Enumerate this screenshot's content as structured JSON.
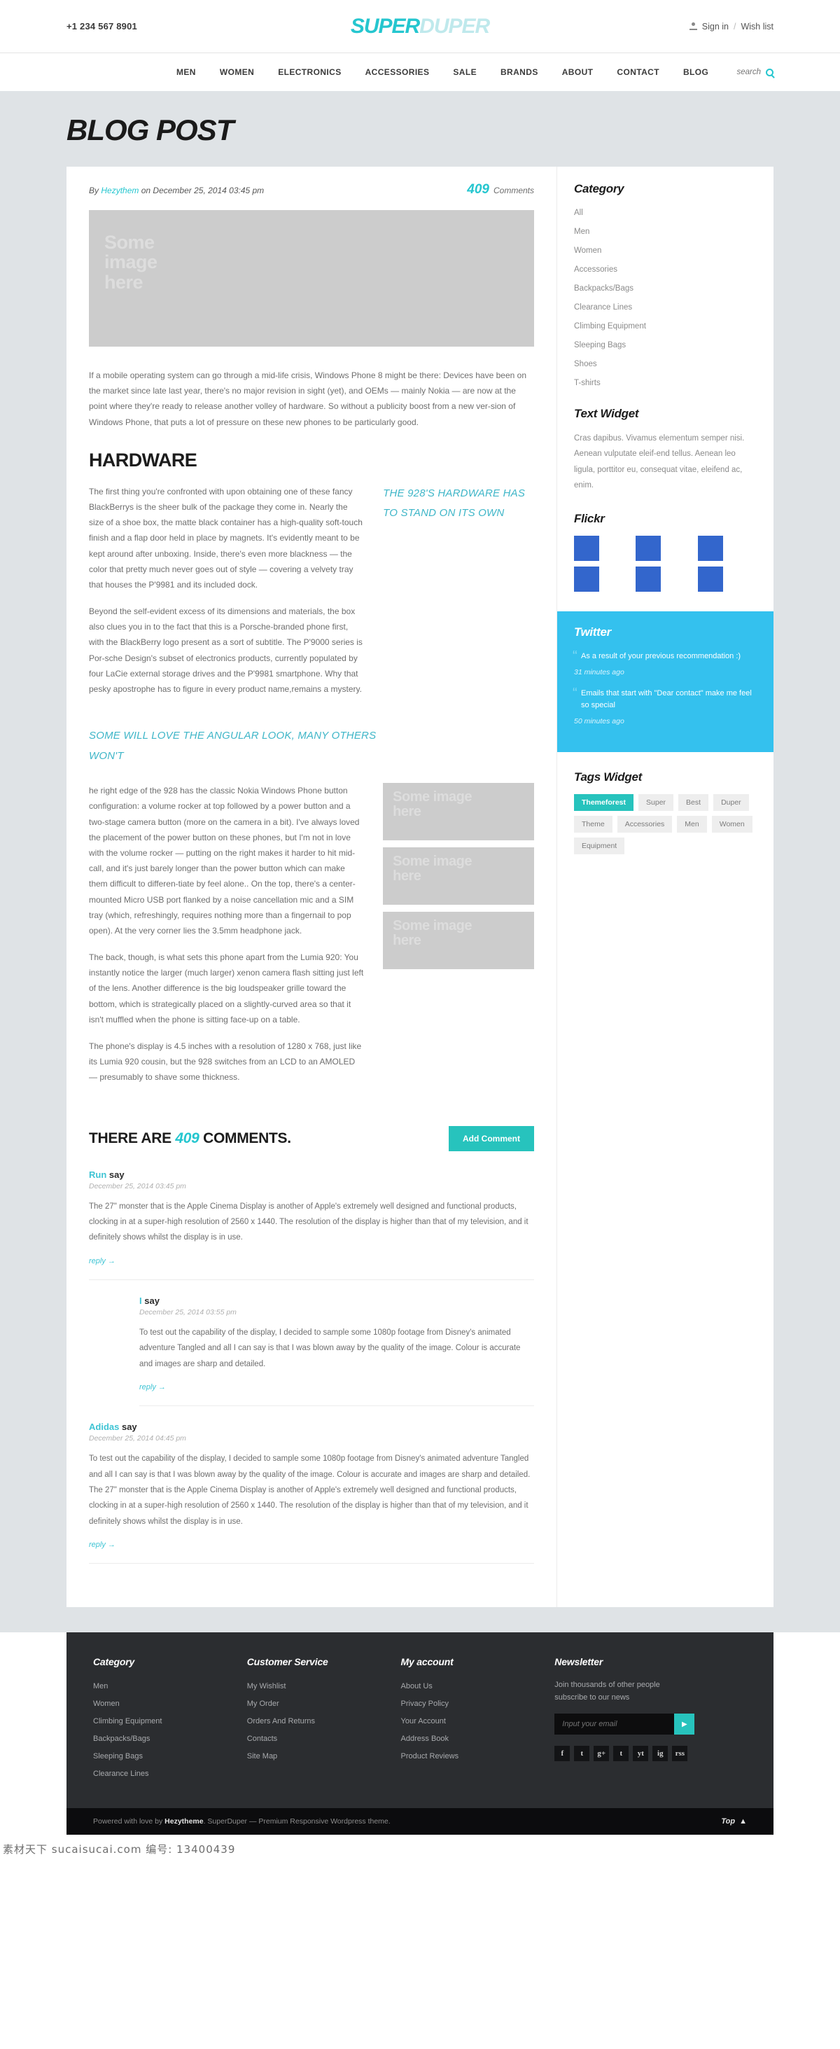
{
  "header": {
    "phone": "+1 234 567 8901",
    "logo_part1": "SUPER",
    "logo_part2": "DUPER",
    "sign_in": "Sign in",
    "separator": "/",
    "wish_list": "Wish list",
    "nav": [
      "MEN",
      "WOMEN",
      "ELECTRONICS",
      "ACCESSORIES",
      "SALE",
      "BRANDS",
      "ABOUT",
      "CONTACT",
      "BLOG"
    ],
    "search_placeholder": "search"
  },
  "banner": {
    "title": "BLOG POST"
  },
  "post": {
    "meta_by": "By",
    "meta_author": "Hezythem",
    "meta_on": "on December 25, 2014 03:45 pm",
    "comment_count": "409",
    "comment_label": "Comments",
    "hero_placeholder": "Some image here",
    "intro": "If a mobile operating system can go through a mid-life crisis, Windows Phone 8 might be there: Devices have been on the market since late last year, there's no major revision in sight (yet), and OEMs — mainly Nokia — are now at the point where they're ready to release another volley of hardware. So without a publicity boost from a new ver-sion of Windows Phone, that puts a lot of pressure on these new phones to be particularly good.",
    "section_title": "HARDWARE",
    "para1": "The first thing you're confronted with upon obtaining one of these fancy BlackBerrys is the sheer bulk of the package they come in. Nearly the size of a shoe box, the matte black container has a high-quality soft-touch finish and a flap door held in place by magnets. It's evidently meant to be kept around after unboxing. Inside, there's even more blackness — the color that pretty much never goes out of style — covering a velvety tray that houses the P'9981 and its included dock.",
    "para2": "Beyond the self-evident excess of its dimensions and materials, the box also clues you in to the fact that this is a Porsche-branded phone first, with the BlackBerry logo present as a sort of subtitle. The P'9000 series is Por-sche Design's subset of electronics products, currently populated by four LaCie external storage drives and the P'9981 smartphone. Why that pesky apostrophe has to figure in every product name,remains a mystery.",
    "pull_quote_1": "THE 928'S HARDWARE HAS TO STAND ON ITS OWN",
    "pull_quote_2": "SOME WILL LOVE THE ANGULAR LOOK, MANY OTHERS WON'T",
    "para3": "he right edge of the 928 has the classic Nokia Windows Phone button configuration: a volume rocker at top followed by a power button and a two-stage camera button (more on the camera in a bit). I've always loved the placement of the power button on these phones, but I'm not in love with the volume rocker — putting on the right makes it harder to hit mid-call, and it's just barely longer than the power button which can make them difficult to differen-tiate by feel alone.. On the top, there's a center-mounted Micro USB port flanked by a noise cancellation mic and a SIM tray (which, refreshingly, requires nothing more than a fingernail to pop open). At the very corner lies the 3.5mm headphone jack.",
    "para4": "The back, though, is what sets this phone apart from the Lumia 920: You instantly notice the larger (much larger) xenon camera flash sitting just left of the lens. Another difference is the big loudspeaker grille toward the bottom, which is strategically placed on a slightly-curved area so that it isn't muffled when the phone is sitting face-up on a table.",
    "para5": "The phone's display is 4.5 inches with a resolution of 1280 x 768, just like its Lumia 920 cousin, but the 928 switches from an LCD to an AMOLED — presumably to shave some thickness.",
    "inline_image_placeholder": "Some image here"
  },
  "comments": {
    "heading_prefix": "THERE ARE",
    "heading_count": "409",
    "heading_suffix": "COMMENTS.",
    "add_button": "Add Comment",
    "say_label": "say",
    "reply_label": "reply →",
    "items": [
      {
        "author": "Run",
        "date": "December 25, 2014 03:45 pm",
        "text": "The 27\" monster that is the Apple Cinema Display is another of Apple's extremely well designed and functional products, clocking in at a super-high resolution of 2560 x 1440. The resolution of the display is higher than that of my television, and it definitely shows whilst the display is in use.",
        "nested": false
      },
      {
        "author": "I",
        "date": "December 25, 2014 03:55 pm",
        "text": "To test out the capability of the display, I decided to sample some 1080p footage from Disney's animated adventure Tangled and all I can say is that I was blown away by the quality of the image. Colour is accurate and images are sharp and detailed.",
        "nested": true
      },
      {
        "author": "Adidas",
        "date": "December 25, 2014 04:45 pm",
        "text": "To test out the capability of the display, I decided to sample some 1080p footage from Disney's animated adventure Tangled and all I can say is that I was blown away by the quality of the image. Colour is accurate and images are sharp and detailed. The 27\" monster that is the Apple Cinema Display is another of Apple's extremely well designed and functional products, clocking in at a super-high resolution of 2560 x 1440. The resolution of the display is higher than that of my television, and it definitely shows whilst the display is in use.",
        "nested": false
      }
    ]
  },
  "sidebar": {
    "category_title": "Category",
    "categories": [
      "All",
      "Men",
      "Women",
      "Accessories",
      "Backpacks/Bags",
      "Clearance Lines",
      "Climbing Equipment",
      "Sleeping Bags",
      "Shoes",
      "T-shirts"
    ],
    "text_widget_title": "Text Widget",
    "text_widget_body": "Cras dapibus. Vivamus elementum semper nisi. Aenean vulputate eleif-end tellus. Aenean leo ligula, porttitor eu, consequat vitae, eleifend ac, enim.",
    "flickr_title": "Flickr",
    "flickr_color": "#3366cc",
    "twitter_title": "Twitter",
    "twitter_bg": "#34c1ee",
    "tweets": [
      {
        "text": "As a result of your previous recommendation :)",
        "time": "31 minutes ago"
      },
      {
        "text": "Emails that start with \"Dear contact\" make me feel so special",
        "time": "50 minutes ago"
      }
    ],
    "tags_title": "Tags Widget",
    "tags": [
      "Themeforest",
      "Super",
      "Best",
      "Duper",
      "Theme",
      "Accessories",
      "Men",
      "Women",
      "Equipment"
    ],
    "tag_active": "Themeforest",
    "accent_color": "#27c3bd"
  },
  "footer": {
    "columns": [
      {
        "title": "Category",
        "links": [
          "Men",
          "Women",
          "Climbing Equipment",
          "Backpacks/Bags",
          "Sleeping Bags",
          "Clearance Lines"
        ]
      },
      {
        "title": "Customer Service",
        "links": [
          "My Wishlist",
          "My Order",
          "Orders And Returns",
          "Contacts",
          "Site Map"
        ]
      },
      {
        "title": "My account",
        "links": [
          "About Us",
          "Privacy Policy",
          "Your Account",
          "Address Book",
          "Product Reviews"
        ]
      }
    ],
    "newsletter_title": "Newsletter",
    "newsletter_text": "Join thousands of other people subscribe to our news",
    "newsletter_placeholder": "Input your email",
    "newsletter_submit": "▶",
    "socials": [
      "f",
      "t",
      "g+",
      "t",
      "yt",
      "ig",
      "rss"
    ]
  },
  "subfooter": {
    "text_prefix": "Powered with love by ",
    "brand": "Hezytheme",
    "text_suffix": ". SuperDuper — Premium Responsive Wordpress theme.",
    "top_label": "Top",
    "top_arrow": "▲"
  },
  "watermark": "素材天下 sucaisucai.com  编号: 13400439"
}
